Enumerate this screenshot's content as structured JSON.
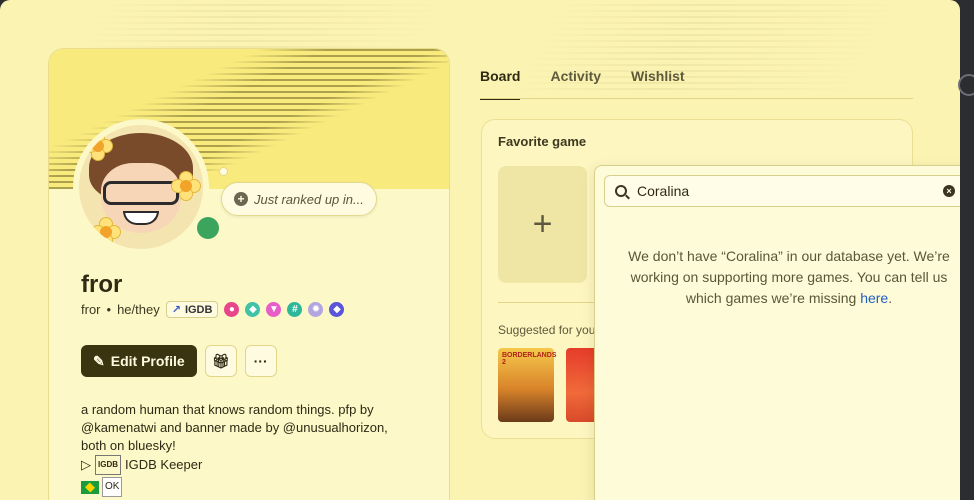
{
  "profile": {
    "status_text": "Just ranked up in...",
    "display_name": "fror",
    "username": "fror",
    "separator": "•",
    "pronouns": "he/they",
    "igdb_tag": "IGDB",
    "edit_profile_label": "Edit Profile",
    "more_label": "···",
    "bio_lines": [
      "a random human that knows random things. pfp by",
      "@kamenatwi and banner made by @unusualhorizon,",
      "both on bluesky!"
    ],
    "keeper_prefix": "▷",
    "keeper_mini": "IGDB",
    "keeper_text": "IGDB Keeper",
    "country_tag": "OK"
  },
  "tabs": [
    {
      "label": "Board",
      "active": true
    },
    {
      "label": "Activity",
      "active": false
    },
    {
      "label": "Wishlist",
      "active": false
    }
  ],
  "board": {
    "favorite_title": "Favorite game",
    "add_symbol": "+",
    "suggested_title": "Suggested for you",
    "cover_1_text": "BORDERLANDS 2"
  },
  "search": {
    "value": "Coralina",
    "clear_symbol": "×",
    "empty_before": "We don’t have “Coralina” in our database yet. We’re working on supporting more games. You can tell us which games we’re missing ",
    "empty_link": "here",
    "empty_after": "."
  },
  "colors": {
    "background": "#fbf3b2",
    "banner": "#f8ea7d",
    "primary_button": "#3a3410",
    "online": "#3ba55d",
    "link": "#1f5fbf"
  }
}
